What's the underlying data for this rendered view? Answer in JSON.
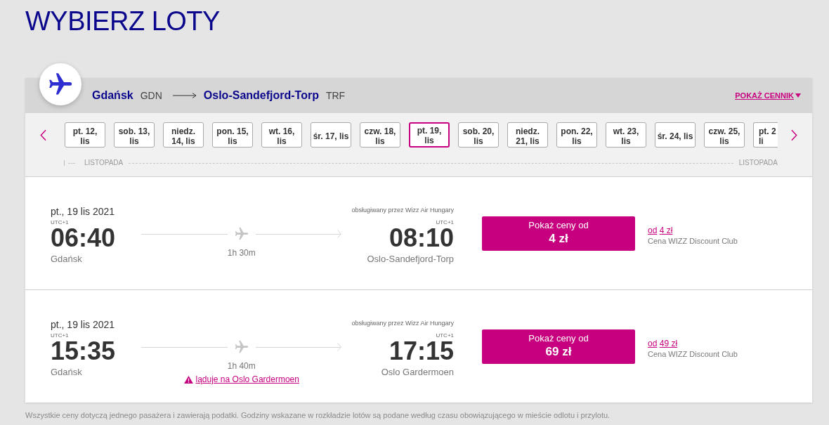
{
  "title": "WYBIERZ LOTY",
  "route": {
    "origin_city": "Gdańsk",
    "origin_code": "GDN",
    "destination_city": "Oslo-Sandefjord-Torp",
    "destination_code": "TRF",
    "price_list_link": "POKAŻ CENNIK"
  },
  "date_strip": {
    "dates": [
      {
        "label": "pt. 12,\nlis",
        "selected": false,
        "kind": "full"
      },
      {
        "label": "sob. 13,\nlis",
        "selected": false,
        "kind": "full"
      },
      {
        "label": "niedz.\n14, lis",
        "selected": false,
        "kind": "full"
      },
      {
        "label": "pon. 15,\nlis",
        "selected": false,
        "kind": "full"
      },
      {
        "label": "wt. 16,\nlis",
        "selected": false,
        "kind": "full"
      },
      {
        "label": "śr. 17, lis",
        "selected": false,
        "kind": "full"
      },
      {
        "label": "czw. 18,\nlis",
        "selected": false,
        "kind": "full"
      },
      {
        "label": "pt. 19,\nlis",
        "selected": true,
        "kind": "full"
      },
      {
        "label": "sob. 20,\nlis",
        "selected": false,
        "kind": "full"
      },
      {
        "label": "niedz.\n21, lis",
        "selected": false,
        "kind": "full"
      },
      {
        "label": "pon. 22,\nlis",
        "selected": false,
        "kind": "full"
      },
      {
        "label": "wt. 23,\nlis",
        "selected": false,
        "kind": "full"
      },
      {
        "label": "śr. 24, lis",
        "selected": false,
        "kind": "full"
      },
      {
        "label": "czw. 25,\nlis",
        "selected": false,
        "kind": "full"
      },
      {
        "label": "pt. 2\nli",
        "selected": false,
        "kind": "partial"
      }
    ],
    "months": [
      "LISTOPADA",
      "LISTOPADA"
    ]
  },
  "flights": [
    {
      "date": "pt., 19 lis 2021",
      "departure": {
        "timezone": "UTC+1",
        "time": "06:40",
        "city": "Gdańsk"
      },
      "duration": "1h 30m",
      "operator": "obsługiwany przez Wizz Air Hungary",
      "arrival": {
        "timezone": "UTC+1",
        "time": "08:10",
        "city": "Oslo-Sandefjord-Torp"
      },
      "price_button": {
        "caption": "Pokaż ceny od",
        "price": "4 zł"
      },
      "club": {
        "prefix": "od",
        "price": "4 zł",
        "label": "Cena WIZZ Discount Club"
      }
    },
    {
      "date": "pt., 19 lis 2021",
      "departure": {
        "timezone": "UTC+1",
        "time": "15:35",
        "city": "Gdańsk"
      },
      "duration": "1h 40m",
      "notice": "ląduje na Oslo Gardermoen",
      "operator": "obsługiwany przez Wizz Air Hungary",
      "arrival": {
        "timezone": "UTC+1",
        "time": "17:15",
        "city": "Oslo Gardermoen"
      },
      "price_button": {
        "caption": "Pokaż ceny od",
        "price": "69 zł"
      },
      "club": {
        "prefix": "od",
        "price": "49 zł",
        "label": "Cena WIZZ Discount Club"
      }
    }
  ],
  "footer_note": "Wszystkie ceny dotyczą jednego pasażera i zawierają podatki. Godziny wskazane w rozkładzie lotów są podane według czasu obowiązującego w mieście odlotu i przylotu."
}
